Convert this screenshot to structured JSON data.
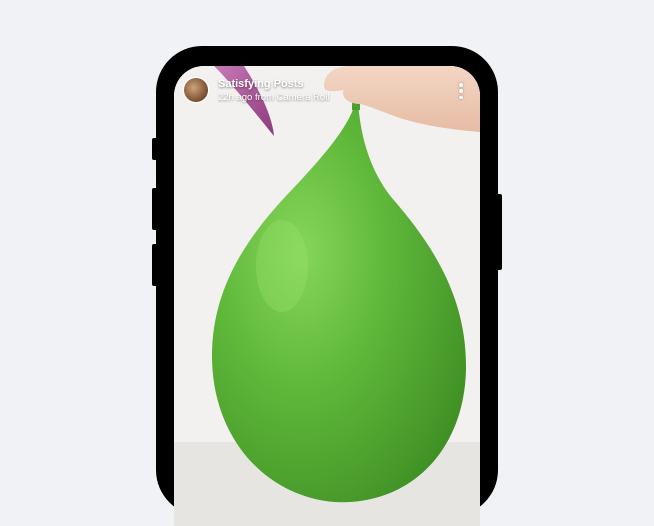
{
  "story": {
    "channel_name": "Satisfying Posts",
    "post_meta": "22h ago from Camera Roll",
    "avatar_icon": "channel-avatar",
    "menu_icon": "more-vertical-icon"
  },
  "colors": {
    "balloon": "#5fb83a",
    "phone_frame": "#000000",
    "background": "#f0f2f6"
  }
}
